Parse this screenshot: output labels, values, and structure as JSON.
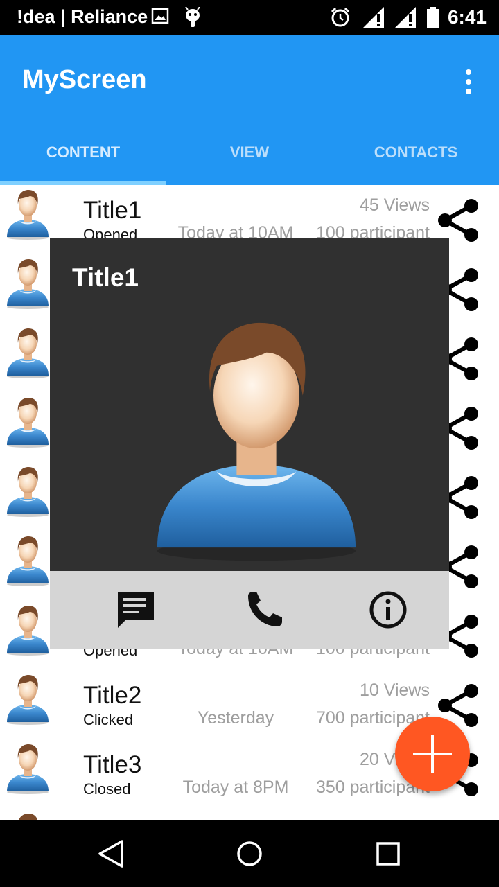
{
  "status_bar": {
    "carrier": "!dea | Reliance",
    "time": "6:41",
    "icons": [
      "image-icon",
      "android-icon",
      "alarm-icon",
      "signal-icon",
      "signal-icon",
      "battery-icon"
    ]
  },
  "app_bar": {
    "title": "MyScreen",
    "tabs": [
      {
        "label": "CONTENT",
        "selected": true
      },
      {
        "label": "VIEW",
        "selected": false
      },
      {
        "label": "CONTACTS",
        "selected": false
      }
    ]
  },
  "list": {
    "items": [
      {
        "title": "Title1",
        "status": "Opened",
        "time": "Today at 10AM",
        "views": "45 Views",
        "participants": "100 participant"
      },
      {
        "title": "",
        "status": "",
        "time": "",
        "views": "",
        "participants": ""
      },
      {
        "title": "",
        "status": "",
        "time": "",
        "views": "",
        "participants": ""
      },
      {
        "title": "",
        "status": "",
        "time": "",
        "views": "",
        "participants": ""
      },
      {
        "title": "",
        "status": "",
        "time": "",
        "views": "",
        "participants": ""
      },
      {
        "title": "",
        "status": "",
        "time": "",
        "views": "",
        "participants": ""
      },
      {
        "title": "",
        "status": "Opened",
        "time": "Today at 10AM",
        "views": "",
        "participants": "100 participant"
      },
      {
        "title": "Title2",
        "status": "Clicked",
        "time": "Yesterday",
        "views": "10 Views",
        "participants": "700 participant"
      },
      {
        "title": "Title3",
        "status": "Closed",
        "time": "Today at 8PM",
        "views": "20 Views",
        "participants": "350 participant"
      }
    ]
  },
  "dialog": {
    "title": "Title1",
    "actions": [
      "message-icon",
      "phone-icon",
      "info-icon"
    ]
  },
  "colors": {
    "primary": "#2196F3",
    "fab": "#FF5722",
    "dialog_bg": "#303030",
    "dialog_actions_bg": "#d5d5d5"
  }
}
